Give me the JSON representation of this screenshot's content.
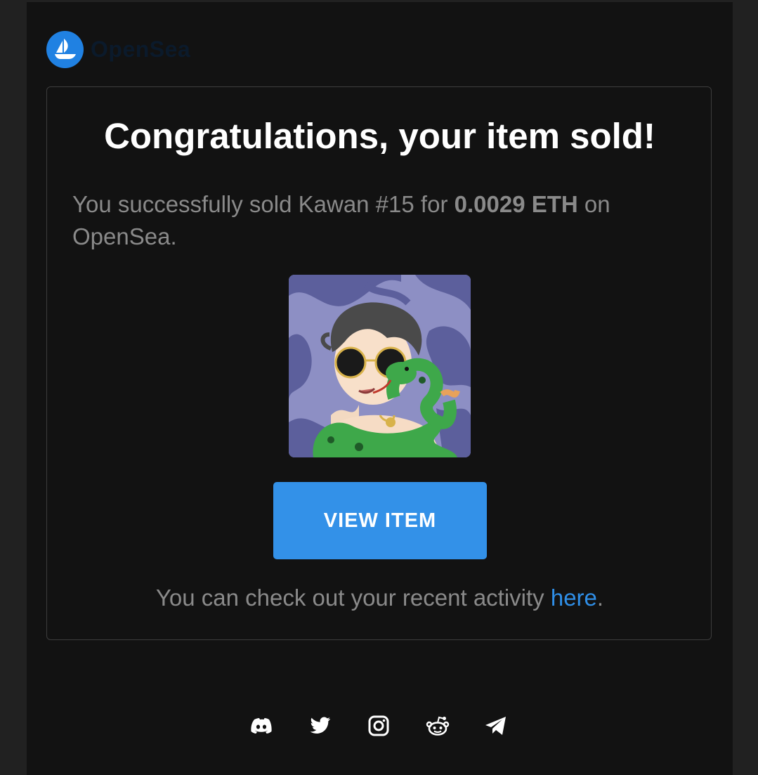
{
  "brand": {
    "name": "OpenSea",
    "logo_icon": "opensea-boat-icon",
    "logo_color": "#2081e2"
  },
  "card": {
    "headline": "Congratulations, your item sold!",
    "message_prefix": "You successfully sold Kawan #15 for ",
    "price": "0.0029 ETH",
    "message_suffix": " on OpenSea.",
    "item_image_alt": "Kawan #15",
    "view_button_label": "VIEW ITEM",
    "activity_prefix": "You can check out your recent activity ",
    "activity_link": "here",
    "activity_suffix": "."
  },
  "footer": {
    "social": [
      {
        "name": "discord",
        "icon": "discord-icon"
      },
      {
        "name": "twitter",
        "icon": "twitter-icon"
      },
      {
        "name": "instagram",
        "icon": "instagram-icon"
      },
      {
        "name": "reddit",
        "icon": "reddit-icon"
      },
      {
        "name": "telegram",
        "icon": "telegram-icon"
      }
    ]
  },
  "colors": {
    "background": "#121212",
    "accent": "#3391e8",
    "link": "#2f8ee6",
    "muted_text": "#8a8a8a"
  }
}
